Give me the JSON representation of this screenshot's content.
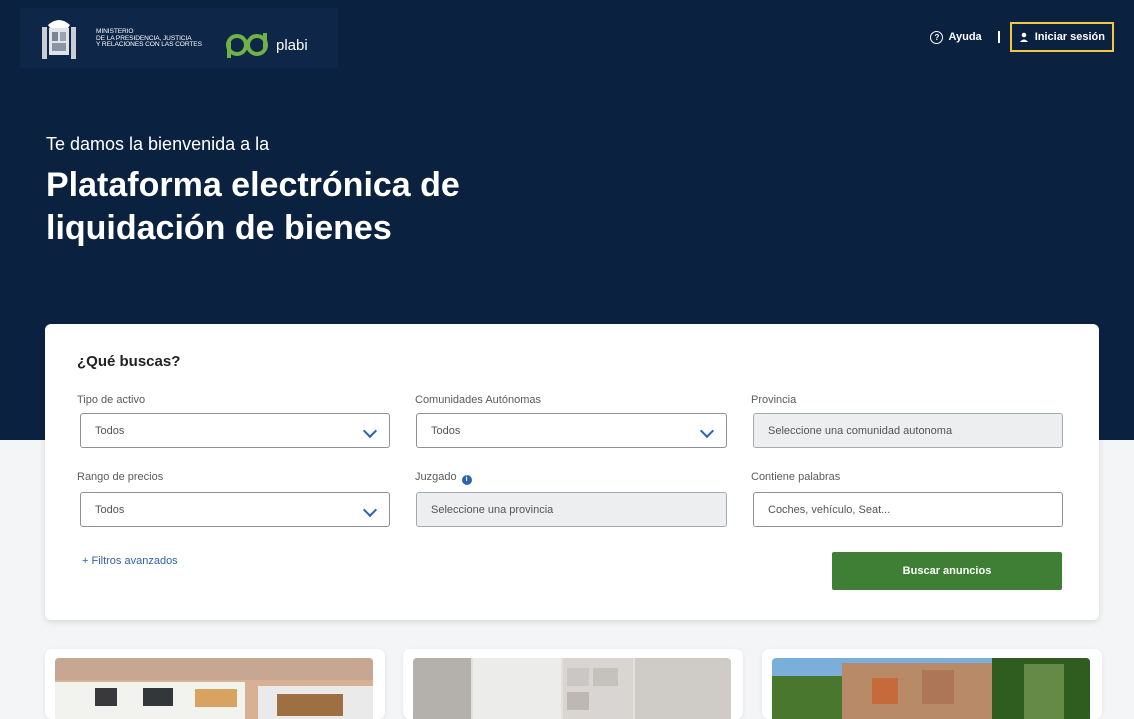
{
  "header": {
    "ministry_lines": [
      "Ministerio",
      "de la Presidencia, Justicia",
      "y Relaciones con las Cortes"
    ],
    "brand": "plabi",
    "help_label": "Ayuda",
    "login_label": "Iniciar sesión",
    "colors": {
      "hero": "#0b2140",
      "highlight": "#f2c744"
    }
  },
  "hero": {
    "welcome": "Te damos la bienvenida a la",
    "title": "Plataforma electrónica de liquidación de bienes"
  },
  "search": {
    "heading": "¿Qué buscas?",
    "fields": {
      "asset_type": {
        "label": "Tipo de activo",
        "value": "Todos"
      },
      "communities": {
        "label": "Comunidades Autónomas",
        "value": "Todos"
      },
      "province": {
        "label": "Provincia",
        "value": "Seleccione una comunidad autonoma"
      },
      "price_range": {
        "label": "Rango de precios",
        "value": "Todos"
      },
      "court": {
        "label": "Juzgado",
        "value": "Seleccione una provincia"
      },
      "keywords": {
        "label": "Contiene palabras",
        "placeholder": "Coches, vehículo, Seat..."
      }
    },
    "advanced_filters": "+ Filtros avanzados",
    "submit_label": "Buscar anuncios",
    "submit_color": "#3f7f35"
  },
  "listings": [
    "house",
    "interior",
    "building"
  ]
}
